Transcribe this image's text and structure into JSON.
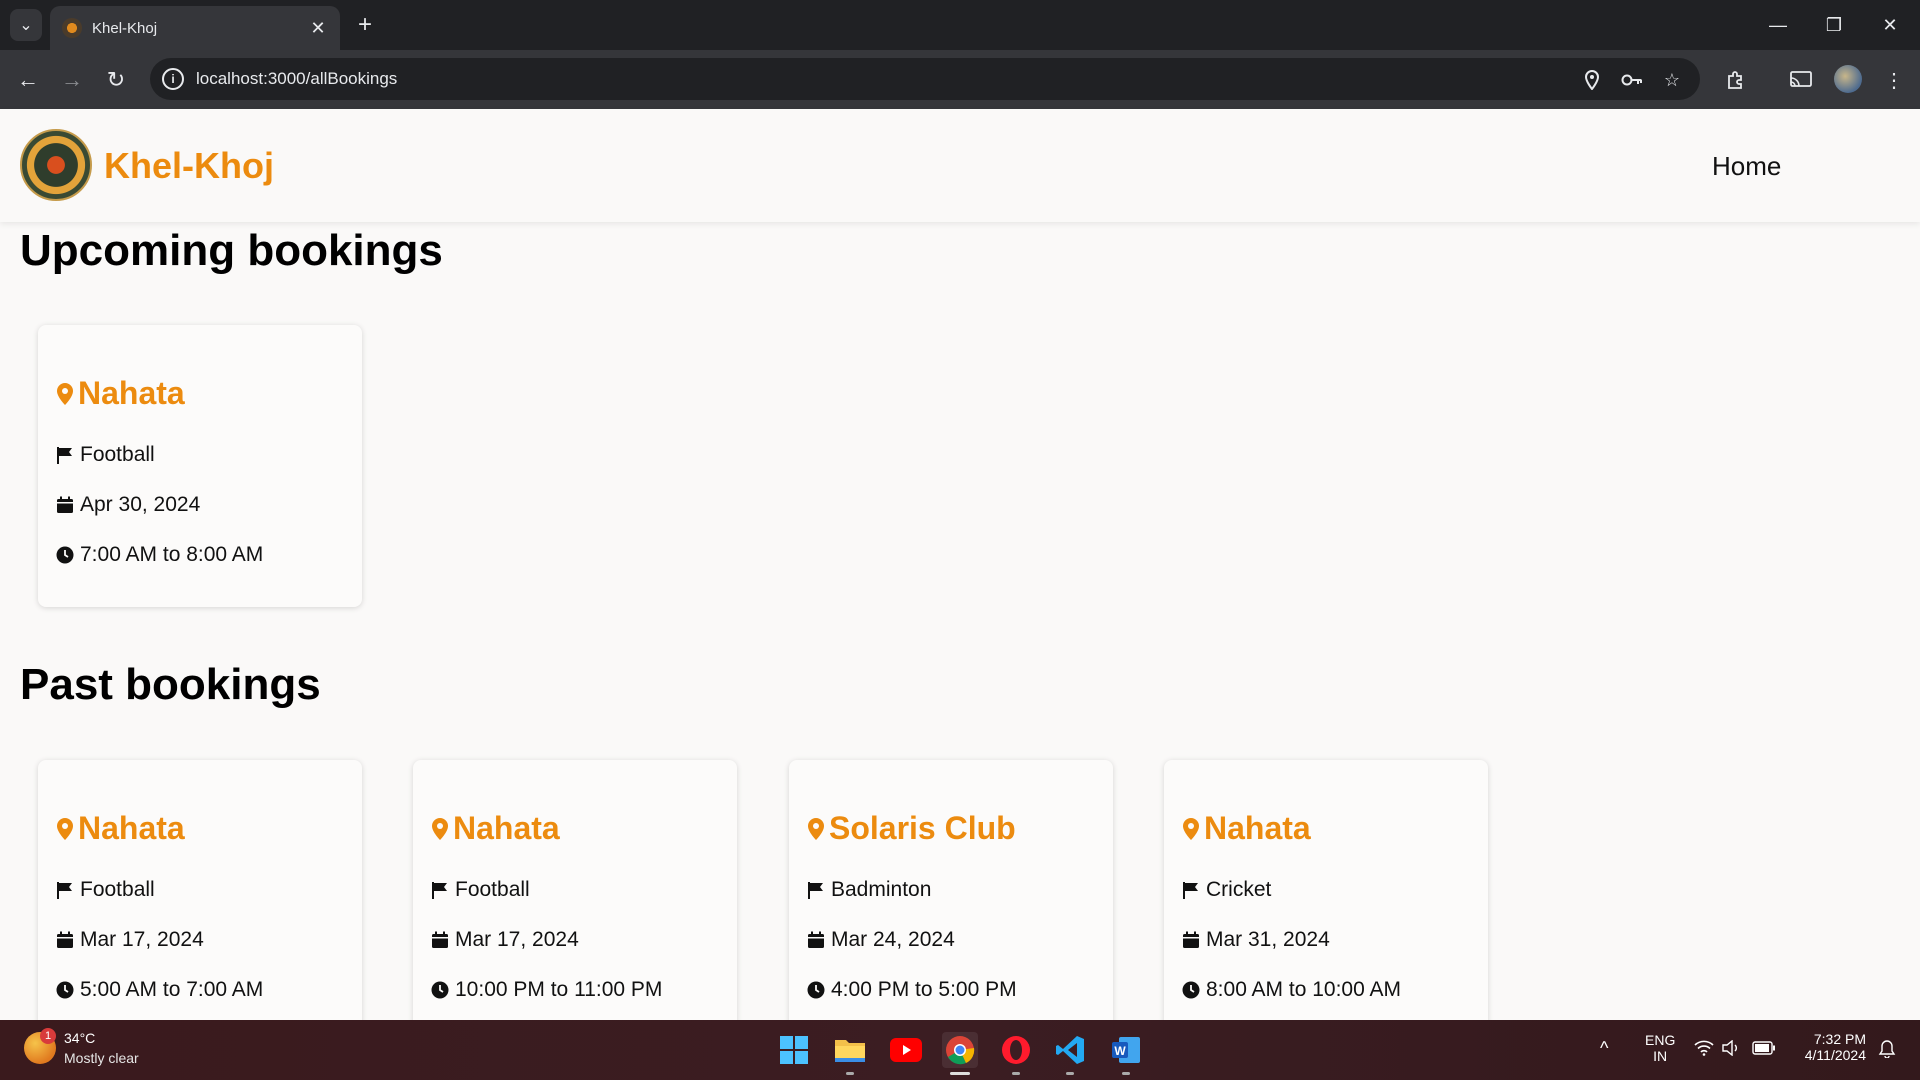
{
  "browser": {
    "tab_title": "Khel-Khoj",
    "url": "localhost:3000/allBookings"
  },
  "site": {
    "brand": "Khel-Khoj",
    "nav_home": "Home"
  },
  "upcoming": {
    "title": "Upcoming bookings",
    "bookings": [
      {
        "venue": "Nahata",
        "sport": "Football",
        "date": "Apr 30, 2024",
        "time": "7:00 AM to 8:00 AM"
      }
    ]
  },
  "past": {
    "title": "Past bookings",
    "bookings": [
      {
        "venue": "Nahata",
        "sport": "Football",
        "date": "Mar 17, 2024",
        "time": "5:00 AM to 7:00 AM"
      },
      {
        "venue": "Nahata",
        "sport": "Football",
        "date": "Mar 17, 2024",
        "time": "10:00 PM to 11:00 PM"
      },
      {
        "venue": "Solaris Club",
        "sport": "Badminton",
        "date": "Mar 24, 2024",
        "time": "4:00 PM to 5:00 PM"
      },
      {
        "venue": "Nahata",
        "sport": "Cricket",
        "date": "Mar 31, 2024",
        "time": "8:00 AM to 10:00 AM"
      }
    ]
  },
  "taskbar": {
    "weather_badge": "1",
    "temperature": "34°C",
    "weather": "Mostly clear",
    "lang_top": "ENG",
    "lang_bottom": "IN",
    "time": "7:32 PM",
    "date": "4/11/2024"
  },
  "colors": {
    "accent": "#ec8b0f",
    "page_bg": "#faf9f8",
    "chrome_dark": "#202124"
  }
}
